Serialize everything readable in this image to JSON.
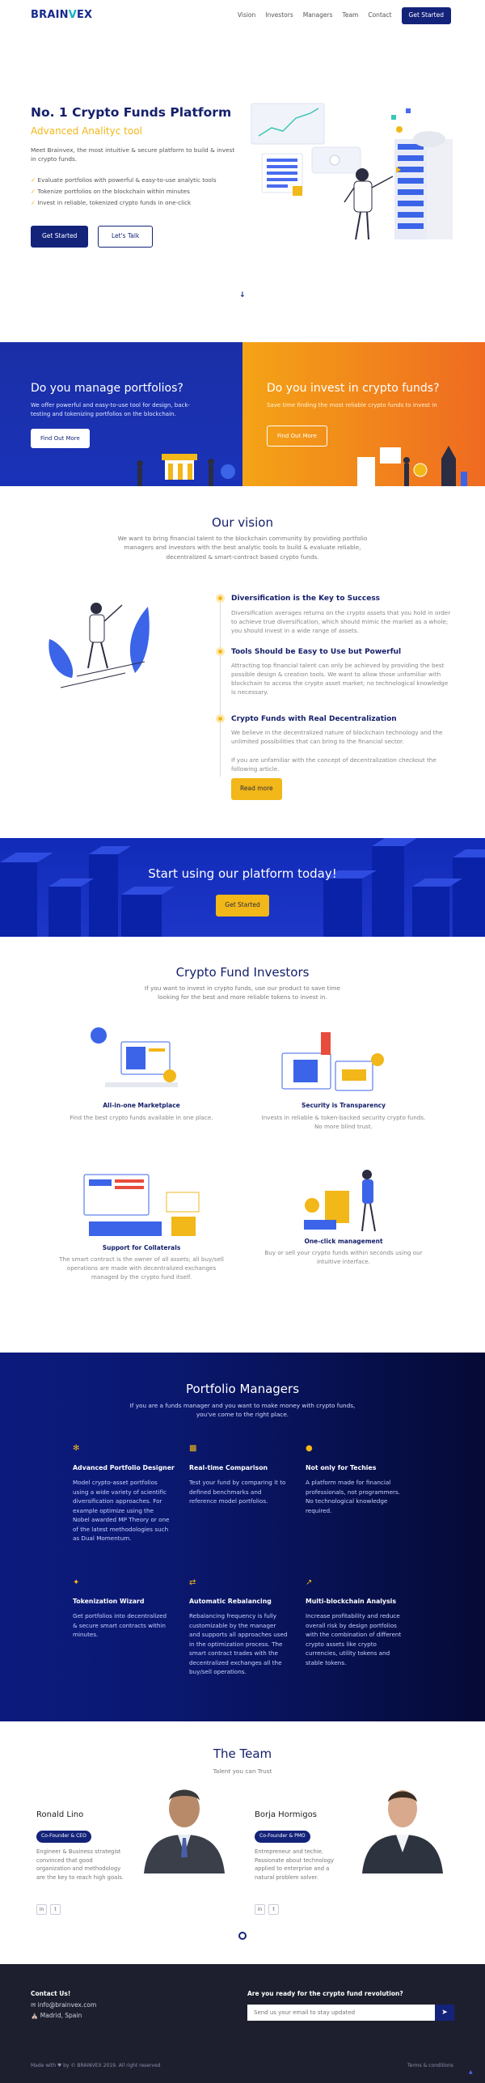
{
  "nav": {
    "logo_a": "BRAIN",
    "logo_b": "V",
    "logo_c": "EX",
    "items": [
      "Vision",
      "Investors",
      "Managers",
      "Team",
      "Contact"
    ],
    "cta": "Get Started"
  },
  "hero": {
    "title": "No. 1 Crypto Funds Platform",
    "subtitle": "Advanced Analityc tool",
    "desc": "Meet Brainvex, the most intuitive & secure platform to build & invest in crypto funds.",
    "bullets": [
      "Evaluate portfolios with powerful & easy-to-use analytic tools",
      "Tokenize portfolios on the blockchain within minutes",
      "Invest in reliable, tokenized crypto funds in one-click"
    ],
    "btn_primary": "Get Started",
    "btn_secondary": "Let's Talk"
  },
  "panels": {
    "manage_title": "Do you manage portfolios?",
    "manage_desc": "We offer powerful and easy-to-use tool for design, back-testing and tokenizing portfolios on the blockchain.",
    "manage_btn": "Find Out More",
    "invest_title": "Do you invest in crypto funds?",
    "invest_desc": "Save time finding the most reliable crypto funds to invest in",
    "invest_btn": "Find Out More"
  },
  "vision": {
    "title": "Our vision",
    "desc": "We want to bring financial talent to the blockchain community by providing portfolio managers and investors with the best analytic tools to build & evaluate reliable, decentralized & smart-contract based crypto funds.",
    "items": [
      {
        "title": "Diversification is the Key to Success",
        "text": "Diversification averages returns on the crypto assets that you hold in order to achieve true diversification, which should mimic the market as a whole; you should invest in a wide range of assets."
      },
      {
        "title": "Tools Should be Easy to Use but Powerful",
        "text": "Attracting top financial talent can only be achieved by providing the best possible design & creation tools. We want to allow those unfamiliar with blockchain to access the crypto asset market; no technological knowledge is necessary."
      },
      {
        "title": "Crypto Funds with Real Decentralization",
        "text": "We believe in the decentralized nature of blockchain technology and the unlimited possibilities that can bring to the financial sector.",
        "text2": "If you are unfamiliar with the concept of decentralization checkout the following article."
      }
    ],
    "read_more": "Read more"
  },
  "cta_band": {
    "title": "Start using our platform today!",
    "btn": "Get Started"
  },
  "investors": {
    "title": "Crypto Fund Investors",
    "desc": "If you want to invest in crypto funds, use our product to save time looking for the best and more reliable tokens to invest in.",
    "items": [
      {
        "title": "All-in-one Marketplace",
        "text": "Find the best crypto funds available in one place."
      },
      {
        "title": "Security is Transparency",
        "text": "Invests in reliable & token-backed security crypto funds. No more blind trust."
      },
      {
        "title": "Support for Collaterals",
        "text": "The smart contract is the owner of all assets; all buy/sell operations are made with decentralized exchanges managed by the crypto fund itself."
      },
      {
        "title": "One-click management",
        "text": "Buy or sell your crypto funds within seconds using our intuitive interface."
      }
    ]
  },
  "managers": {
    "title": "Portfolio Managers",
    "desc": "If you are a funds manager and you want to make money with crypto funds, you've come to the right place.",
    "items": [
      {
        "title": "Advanced Portfolio Designer",
        "text": "Model crypto-asset portfolios using a wide variety of scientific diversification approaches. For example optimize using the Nobel awarded MP Theory or one of the latest methodologies such as Dual Momentum."
      },
      {
        "title": "Real-time Comparison",
        "text": "Test your fund by comparing it to defined benchmarks and reference model portfolios."
      },
      {
        "title": "Not only for Techies",
        "text": "A platform made for financial professionals, not programmers. No technological knowledge required."
      },
      {
        "title": "Tokenization Wizard",
        "text": "Get portfolios into decentralized & secure smart contracts within minutes."
      },
      {
        "title": "Automatic Rebalancing",
        "text": "Rebalancing frequency is fully customizable by the manager and supports all approaches used in the optimization process. The smart contract trades with the decentralized exchanges all the buy/sell operations."
      },
      {
        "title": "Multi-blockchain Analysis",
        "text": "Increase profitability and reduce overall risk by design portfolios with the combination of different crypto assets like crypto currencies, utility tokens and stable tokens."
      }
    ]
  },
  "team": {
    "title": "The Team",
    "subtitle": "Talent you can Trust",
    "members": [
      {
        "name": "Ronald Lino",
        "role": "Co-Founder & CEO",
        "bio": "Engineer & Business strategist convinced that good organization and methodology are the key to reach high goals."
      },
      {
        "name": "Borja Hormigos",
        "role": "Co-Founder & PMO",
        "bio": "Entrepreneur and techie. Passionate about technology applied to enterprise and a natural problem solver."
      }
    ]
  },
  "footer": {
    "contact_title": "Contact Us!",
    "email": "info@brainvex.com",
    "location": "Madrid, Spain",
    "newsletter_title": "Are you ready for the crypto fund revolution?",
    "email_placeholder": "Send us your email to stay updated",
    "copyright": "Made with ♥ by © BRAINVEX 2019. All right reserved",
    "terms": "Terms & conditions"
  },
  "colors": {
    "navy": "#14237a",
    "gold": "#f2b718",
    "blue": "#1a32b8",
    "orange": "#ef6a21"
  }
}
